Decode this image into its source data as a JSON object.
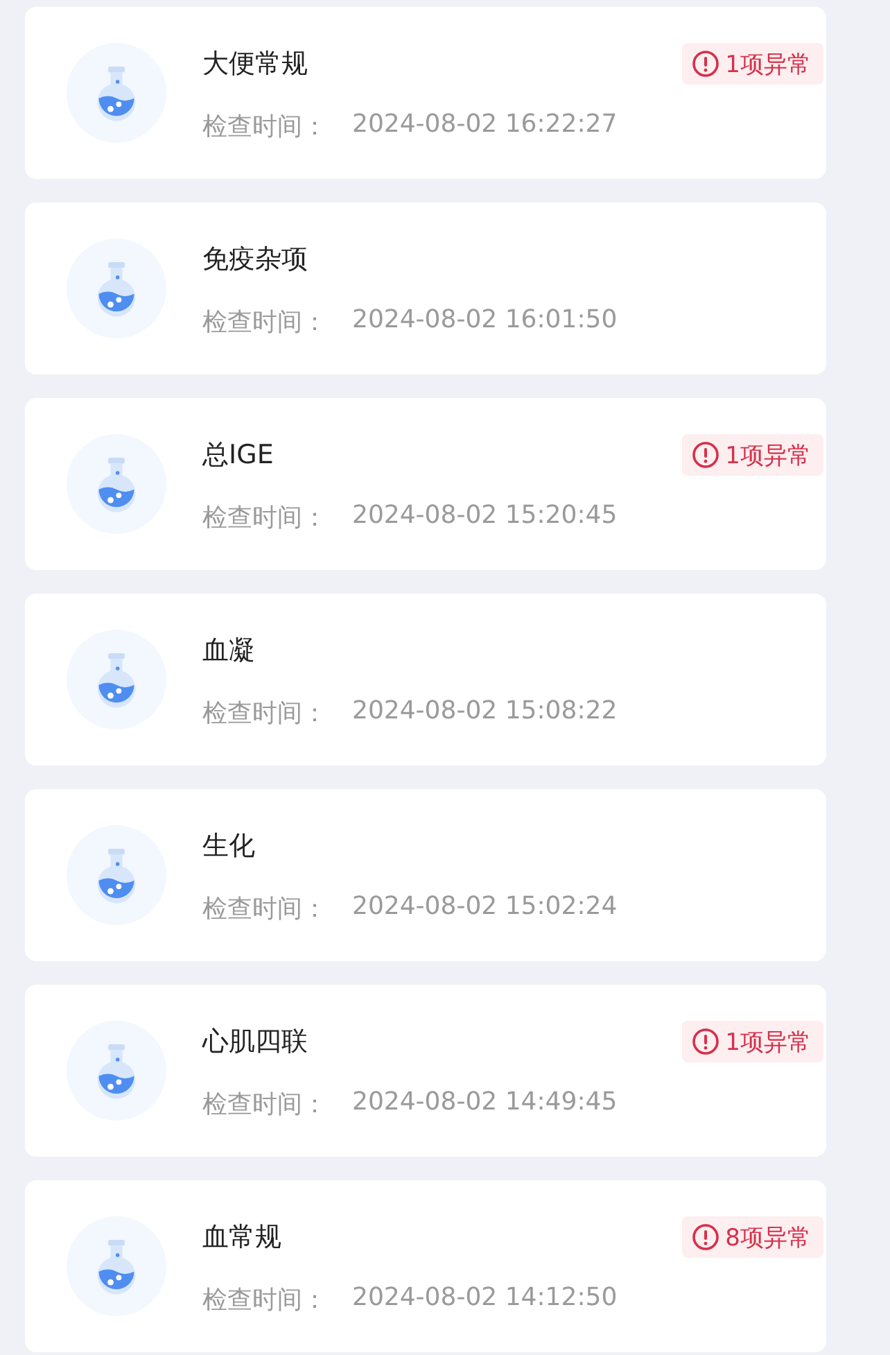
{
  "reports": [
    {
      "title": "大便常规",
      "time_label": "检查时间：",
      "time": "2024-08-02 16:22:27",
      "alert": "1项异常"
    },
    {
      "title": "免疫杂项",
      "time_label": "检查时间：",
      "time": "2024-08-02 16:01:50"
    },
    {
      "title": "总IGE",
      "time_label": "检查时间：",
      "time": "2024-08-02 15:20:45",
      "alert": "1项异常"
    },
    {
      "title": "血凝",
      "time_label": "检查时间：",
      "time": "2024-08-02 15:08:22"
    },
    {
      "title": "生化",
      "time_label": "检查时间：",
      "time": "2024-08-02 15:02:24"
    },
    {
      "title": "心肌四联",
      "time_label": "检查时间：",
      "time": "2024-08-02 14:49:45",
      "alert": "1项异常"
    },
    {
      "title": "血常规",
      "time_label": "检查时间：",
      "time": "2024-08-02 14:12:50",
      "alert": "8项异常"
    }
  ]
}
